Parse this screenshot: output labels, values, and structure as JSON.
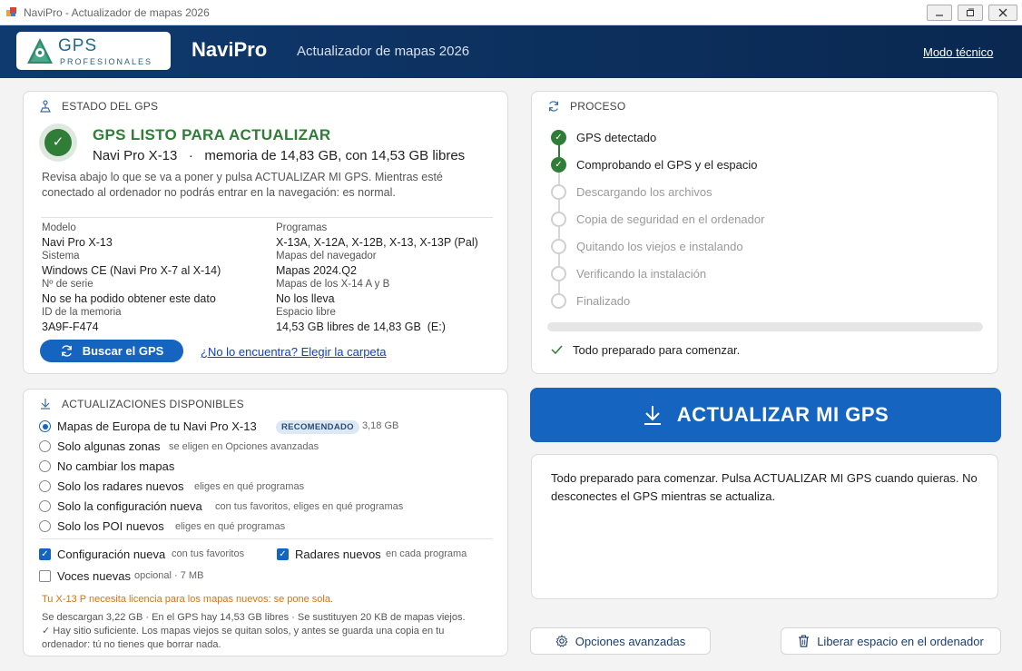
{
  "window": {
    "title": "NaviPro - Actualizador de mapas 2026"
  },
  "header": {
    "logo_main": "GPS",
    "logo_sub": "PROFESIONALES",
    "app_name": "NaviPro",
    "subtitle": "Actualizador de mapas 2026",
    "tech_mode_link": "Modo técnico"
  },
  "estado": {
    "heading": "ESTADO DEL GPS",
    "status_title": "GPS LISTO PARA ACTUALIZAR",
    "status_sub": "Navi Pro X-13   ·   memoria de 14,83 GB, con 14,53 GB libres",
    "description": "Revisa abajo lo que se va a poner y pulsa ACTUALIZAR MI GPS. Mientras esté conectado al ordenador no podrás entrar en la navegación: es normal.",
    "fields": {
      "modelo_k": "Modelo",
      "modelo_v": "Navi Pro X-13",
      "sistema_k": "Sistema",
      "sistema_v": "Windows CE (Navi Pro X-7 al X-14)",
      "serie_k": "Nº de serie",
      "serie_v": "No se ha podido obtener este dato",
      "idmem_k": "ID de la memoria",
      "idmem_v": "3A9F-F474",
      "programas_k": "Programas",
      "programas_v": "X-13A, X-12A, X-12B, X-13, X-13P (Pal)",
      "mapasnav_k": "Mapas del navegador",
      "mapasnav_v": "Mapas 2024.Q2",
      "mapas14_k": "Mapas de los X-14 A y B",
      "mapas14_v": "No los lleva",
      "espacio_k": "Espacio libre",
      "espacio_v": "14,53 GB libres de 14,83 GB  (E:)"
    },
    "search_button": "Buscar el GPS",
    "folder_link": "¿No lo encuentra? Elegir la carpeta"
  },
  "updates": {
    "heading": "ACTUALIZACIONES DISPONIBLES",
    "options": [
      {
        "label": "Mapas de Europa de tu Navi Pro X-13",
        "badge": "RECOMENDADO",
        "hint": "3,18 GB",
        "selected": true
      },
      {
        "label": "Solo algunas zonas",
        "hint": "se eligen en Opciones avanzadas",
        "selected": false
      },
      {
        "label": "No cambiar los mapas",
        "hint": "",
        "selected": false
      },
      {
        "label": "Solo los radares nuevos",
        "hint": "eliges en qué programas",
        "selected": false
      },
      {
        "label": "Solo la configuración nueva",
        "hint": "con tus favoritos, eliges en qué programas",
        "selected": false
      },
      {
        "label": "Solo los POI nuevos",
        "hint": "eliges en qué programas",
        "selected": false
      }
    ],
    "checks": [
      {
        "label": "Configuración nueva",
        "hint": "con tus favoritos",
        "checked": true
      },
      {
        "label": "Radares nuevos",
        "hint": "en cada programa",
        "checked": true
      },
      {
        "label": "Voces nuevas",
        "hint": "opcional · 7 MB",
        "checked": false
      }
    ],
    "warning": "Tu X-13 P necesita licencia para los mapas nuevos: se pone sola.",
    "note1": "Se descargan 3,22 GB · En el GPS hay 14,53 GB libres · Se sustituyen 20 KB de mapas viejos.",
    "note2": "✓ Hay sitio suficiente. Los mapas viejos se quitan solos, y antes se guarda una copia en tu ordenador: tú no tienes que borrar nada."
  },
  "proceso": {
    "heading": "PROCESO",
    "steps": [
      {
        "label": "GPS detectado",
        "done": true
      },
      {
        "label": "Comprobando el GPS y el espacio",
        "done": true
      },
      {
        "label": "Descargando los archivos",
        "done": false
      },
      {
        "label": "Copia de seguridad en el ordenador",
        "done": false
      },
      {
        "label": "Quitando los viejos e instalando",
        "done": false
      },
      {
        "label": "Verificando la instalación",
        "done": false
      },
      {
        "label": "Finalizado",
        "done": false
      }
    ],
    "progress": 0,
    "ready_text": "Todo preparado para comenzar."
  },
  "action": {
    "main_button": "ACTUALIZAR MI GPS",
    "message": "Todo preparado para comenzar. Pulsa ACTUALIZAR MI GPS cuando quieras. No desconectes el GPS mientras se actualiza.",
    "advanced_button": "Opciones avanzadas",
    "free_space_button": "Liberar espacio en el ordenador"
  },
  "colors": {
    "accent": "#1565c0",
    "success": "#2f7d36",
    "warning": "#d9730d",
    "header": "#0f3a70"
  }
}
